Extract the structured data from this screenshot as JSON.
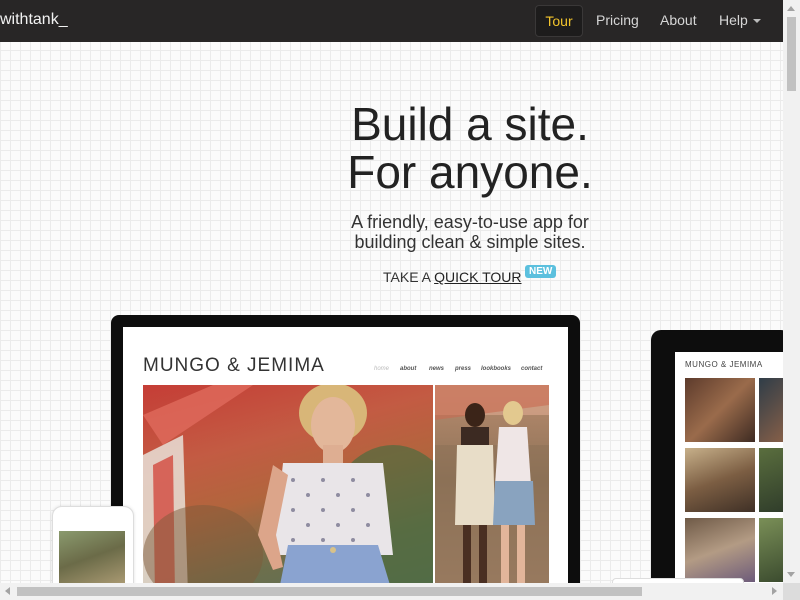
{
  "navbar": {
    "brand": "withtank_",
    "items": [
      {
        "label": "Tour",
        "active": true
      },
      {
        "label": "Pricing"
      },
      {
        "label": "About"
      },
      {
        "label": "Help"
      }
    ],
    "active_color": "#f2c42c"
  },
  "hero": {
    "title_line1": "Build a site.",
    "title_line2": "For anyone.",
    "subtitle_line1": "A friendly, easy-to-use app for",
    "subtitle_line2": "building clean & simple sites.",
    "cta_prefix": "TAKE A",
    "cta_link": "QUICK TOUR",
    "badge": "NEW",
    "badge_color": "#5bc0de"
  },
  "showcase": {
    "site_logo": "MUNGO & JEMIMA",
    "site_nav": [
      "home",
      "about",
      "news",
      "press",
      "lookbooks",
      "contact"
    ],
    "tablet_logo": "MUNGO & JEMIMA"
  }
}
